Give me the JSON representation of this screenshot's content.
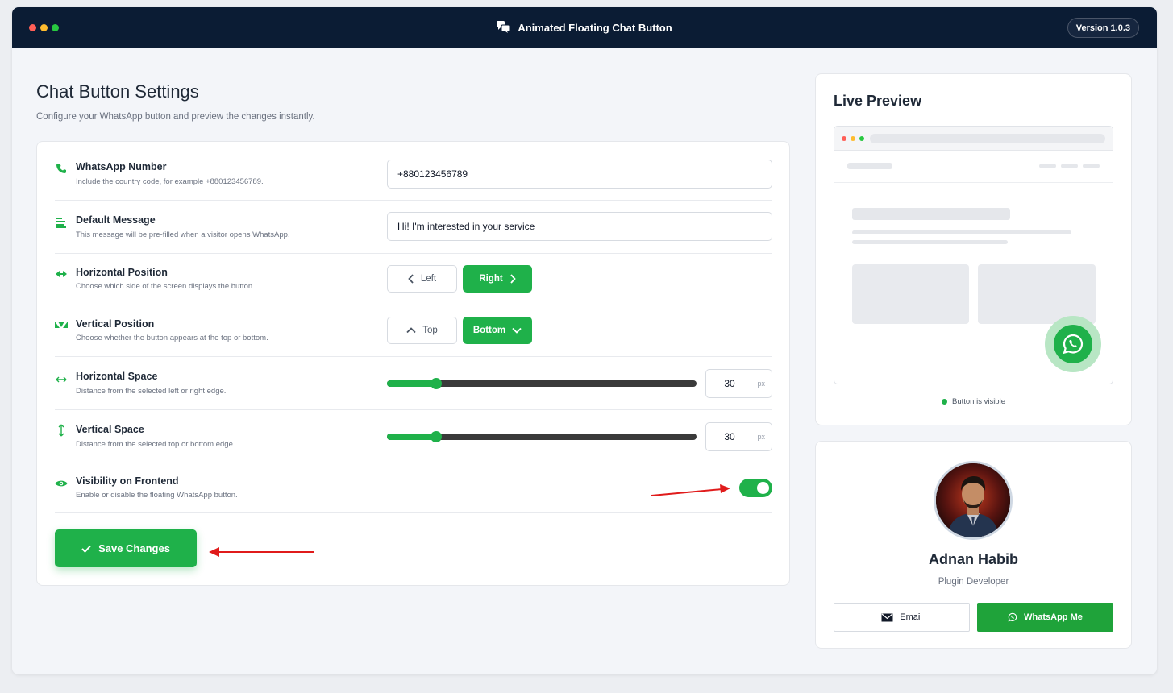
{
  "header": {
    "title": "Animated Floating Chat Button",
    "version": "Version 1.0.3",
    "dot_colors": [
      "#ff5f57",
      "#febc2e",
      "#28c840"
    ]
  },
  "page": {
    "title": "Chat Button Settings",
    "subtitle": "Configure your WhatsApp button and preview the changes instantly."
  },
  "settings": {
    "whatsapp_number": {
      "label": "WhatsApp Number",
      "desc": "Include the country code, for example +880123456789.",
      "value": "+880123456789"
    },
    "default_message": {
      "label": "Default Message",
      "desc": "This message will be pre-filled when a visitor opens WhatsApp.",
      "value": "Hi! I'm interested in your service"
    },
    "horizontal_position": {
      "label": "Horizontal Position",
      "desc": "Choose which side of the screen displays the button.",
      "options": [
        "Left",
        "Right"
      ],
      "selected": "Right"
    },
    "vertical_position": {
      "label": "Vertical Position",
      "desc": "Choose whether the button appears at the top or bottom.",
      "options": [
        "Top",
        "Bottom"
      ],
      "selected": "Bottom"
    },
    "horizontal_space": {
      "label": "Horizontal Space",
      "desc": "Distance from the selected left or right edge.",
      "value": "30",
      "unit": "px",
      "slider_fraction": 0.16
    },
    "vertical_space": {
      "label": "Vertical Space",
      "desc": "Distance from the selected top or bottom edge.",
      "value": "30",
      "unit": "px",
      "slider_fraction": 0.16
    },
    "visibility": {
      "label": "Visibility on Frontend",
      "desc": "Enable or disable the floating WhatsApp button.",
      "enabled": true
    },
    "save_label": "Save Changes"
  },
  "preview": {
    "title": "Live Preview",
    "status": "Button is visible"
  },
  "profile": {
    "name": "Adnan Habib",
    "role": "Plugin Developer",
    "email_label": "Email",
    "whatsapp_label": "WhatsApp Me"
  },
  "colors": {
    "accent": "#1fb14a",
    "header_bg": "#0b1c34",
    "annotation_arrow": "#e01b1b"
  }
}
